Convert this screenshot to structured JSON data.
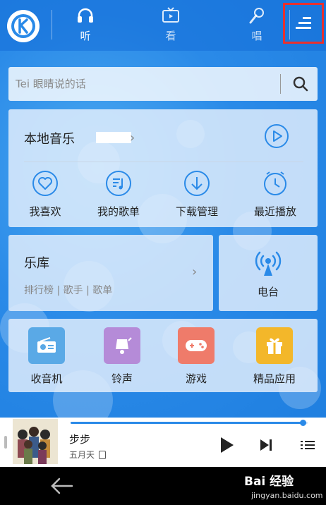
{
  "topbar": {
    "tabs": [
      {
        "label": "听",
        "icon": "headphones-icon"
      },
      {
        "label": "看",
        "icon": "tv-icon"
      },
      {
        "label": "唱",
        "icon": "microphone-icon"
      }
    ],
    "menu_icon": "menu-icon",
    "logo_icon": "kugou-logo-icon"
  },
  "search": {
    "placeholder": "Tei 眼睛说的话"
  },
  "local": {
    "title": "本地音乐",
    "shortcuts": [
      {
        "label": "我喜欢",
        "icon": "heart-icon"
      },
      {
        "label": "我的歌单",
        "icon": "playlist-icon"
      },
      {
        "label": "下载管理",
        "icon": "download-icon"
      },
      {
        "label": "最近播放",
        "icon": "clock-icon"
      }
    ]
  },
  "library": {
    "title": "乐库",
    "subtitle": "排行榜 | 歌手 | 歌单"
  },
  "radio": {
    "label": "电台",
    "icon": "broadcast-icon"
  },
  "apps": [
    {
      "label": "收音机",
      "icon": "radio-icon",
      "color": "#5aa9e6"
    },
    {
      "label": "铃声",
      "icon": "bell-icon",
      "color": "#b58bd8"
    },
    {
      "label": "游戏",
      "icon": "gamepad-icon",
      "color": "#ef7b6a"
    },
    {
      "label": "精品应用",
      "icon": "gift-icon",
      "color": "#f3b72a"
    }
  ],
  "player": {
    "song": "步步",
    "artist": "五月天",
    "progress": 0.98
  },
  "watermark": {
    "brand": "Bai 经验",
    "url": "jingyan.baidu.com"
  },
  "colors": {
    "accent": "#2a8ae8",
    "highlight_box": "#e8312f"
  }
}
